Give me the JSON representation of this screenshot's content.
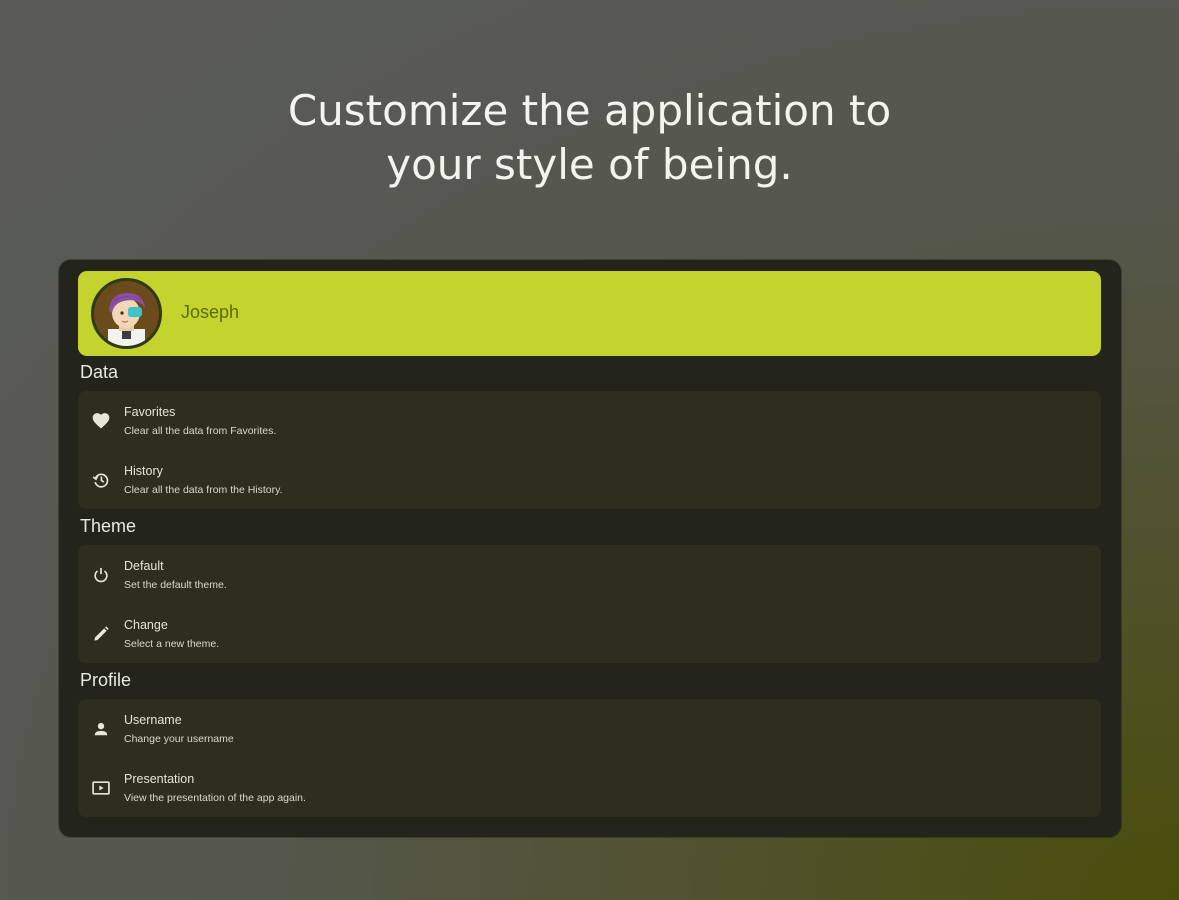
{
  "headline": {
    "line1": "Customize the application to",
    "line2": "your style of being."
  },
  "profile": {
    "name": "Joseph",
    "avatar_icon": "avatar-illustration"
  },
  "colors": {
    "header_accent": "#c4d32d",
    "frame_background": "#23241c",
    "card_background": "#2d2e1d"
  },
  "sections": [
    {
      "title": "Data",
      "items": [
        {
          "icon": "heart-icon",
          "title": "Favorites",
          "subtitle": "Clear all the data from Favorites."
        },
        {
          "icon": "history-icon",
          "title": "History",
          "subtitle": "Clear all the data from the History."
        }
      ]
    },
    {
      "title": "Theme",
      "items": [
        {
          "icon": "power-icon",
          "title": "Default",
          "subtitle": "Set the default theme."
        },
        {
          "icon": "pencil-icon",
          "title": "Change",
          "subtitle": "Select a new theme."
        }
      ]
    },
    {
      "title": "Profile",
      "items": [
        {
          "icon": "person-icon",
          "title": "Username",
          "subtitle": "Change your username"
        },
        {
          "icon": "presentation-icon",
          "title": "Presentation",
          "subtitle": "View the presentation of the app again."
        }
      ]
    }
  ]
}
